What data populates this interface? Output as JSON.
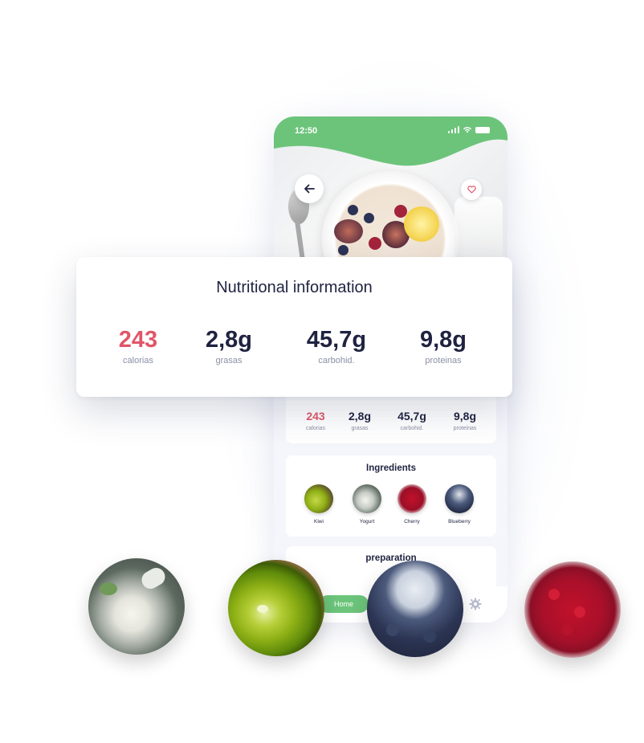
{
  "status_bar": {
    "time": "12:50"
  },
  "nutrition_card": {
    "title": "Nutritional information",
    "items": [
      {
        "value": "243",
        "label": "calorias"
      },
      {
        "value": "2,8g",
        "label": "grasas"
      },
      {
        "value": "45,7g",
        "label": "carbohid."
      },
      {
        "value": "9,8g",
        "label": "proteinas"
      }
    ]
  },
  "ingredients": {
    "title": "Ingredients",
    "items": [
      {
        "name": "Kiwi",
        "icon": "kiwi-image"
      },
      {
        "name": "Yogurt",
        "icon": "yogurt-image"
      },
      {
        "name": "Cherry",
        "icon": "cherry-image"
      },
      {
        "name": "Blueberry",
        "icon": "blueberry-image"
      }
    ]
  },
  "preparation": {
    "title": "preparation"
  },
  "bottom_nav": {
    "home_label": "Home"
  },
  "icons": {
    "back": "arrow-left-icon",
    "favorite": "heart-icon",
    "settings": "gear-icon",
    "signal": "signal-icon",
    "wifi": "wifi-icon",
    "battery": "battery-icon"
  },
  "colors": {
    "brand_green": "#6cc47a",
    "accent_red": "#e0566a",
    "text_dark": "#1f2340",
    "text_muted": "#8a8fa5"
  }
}
